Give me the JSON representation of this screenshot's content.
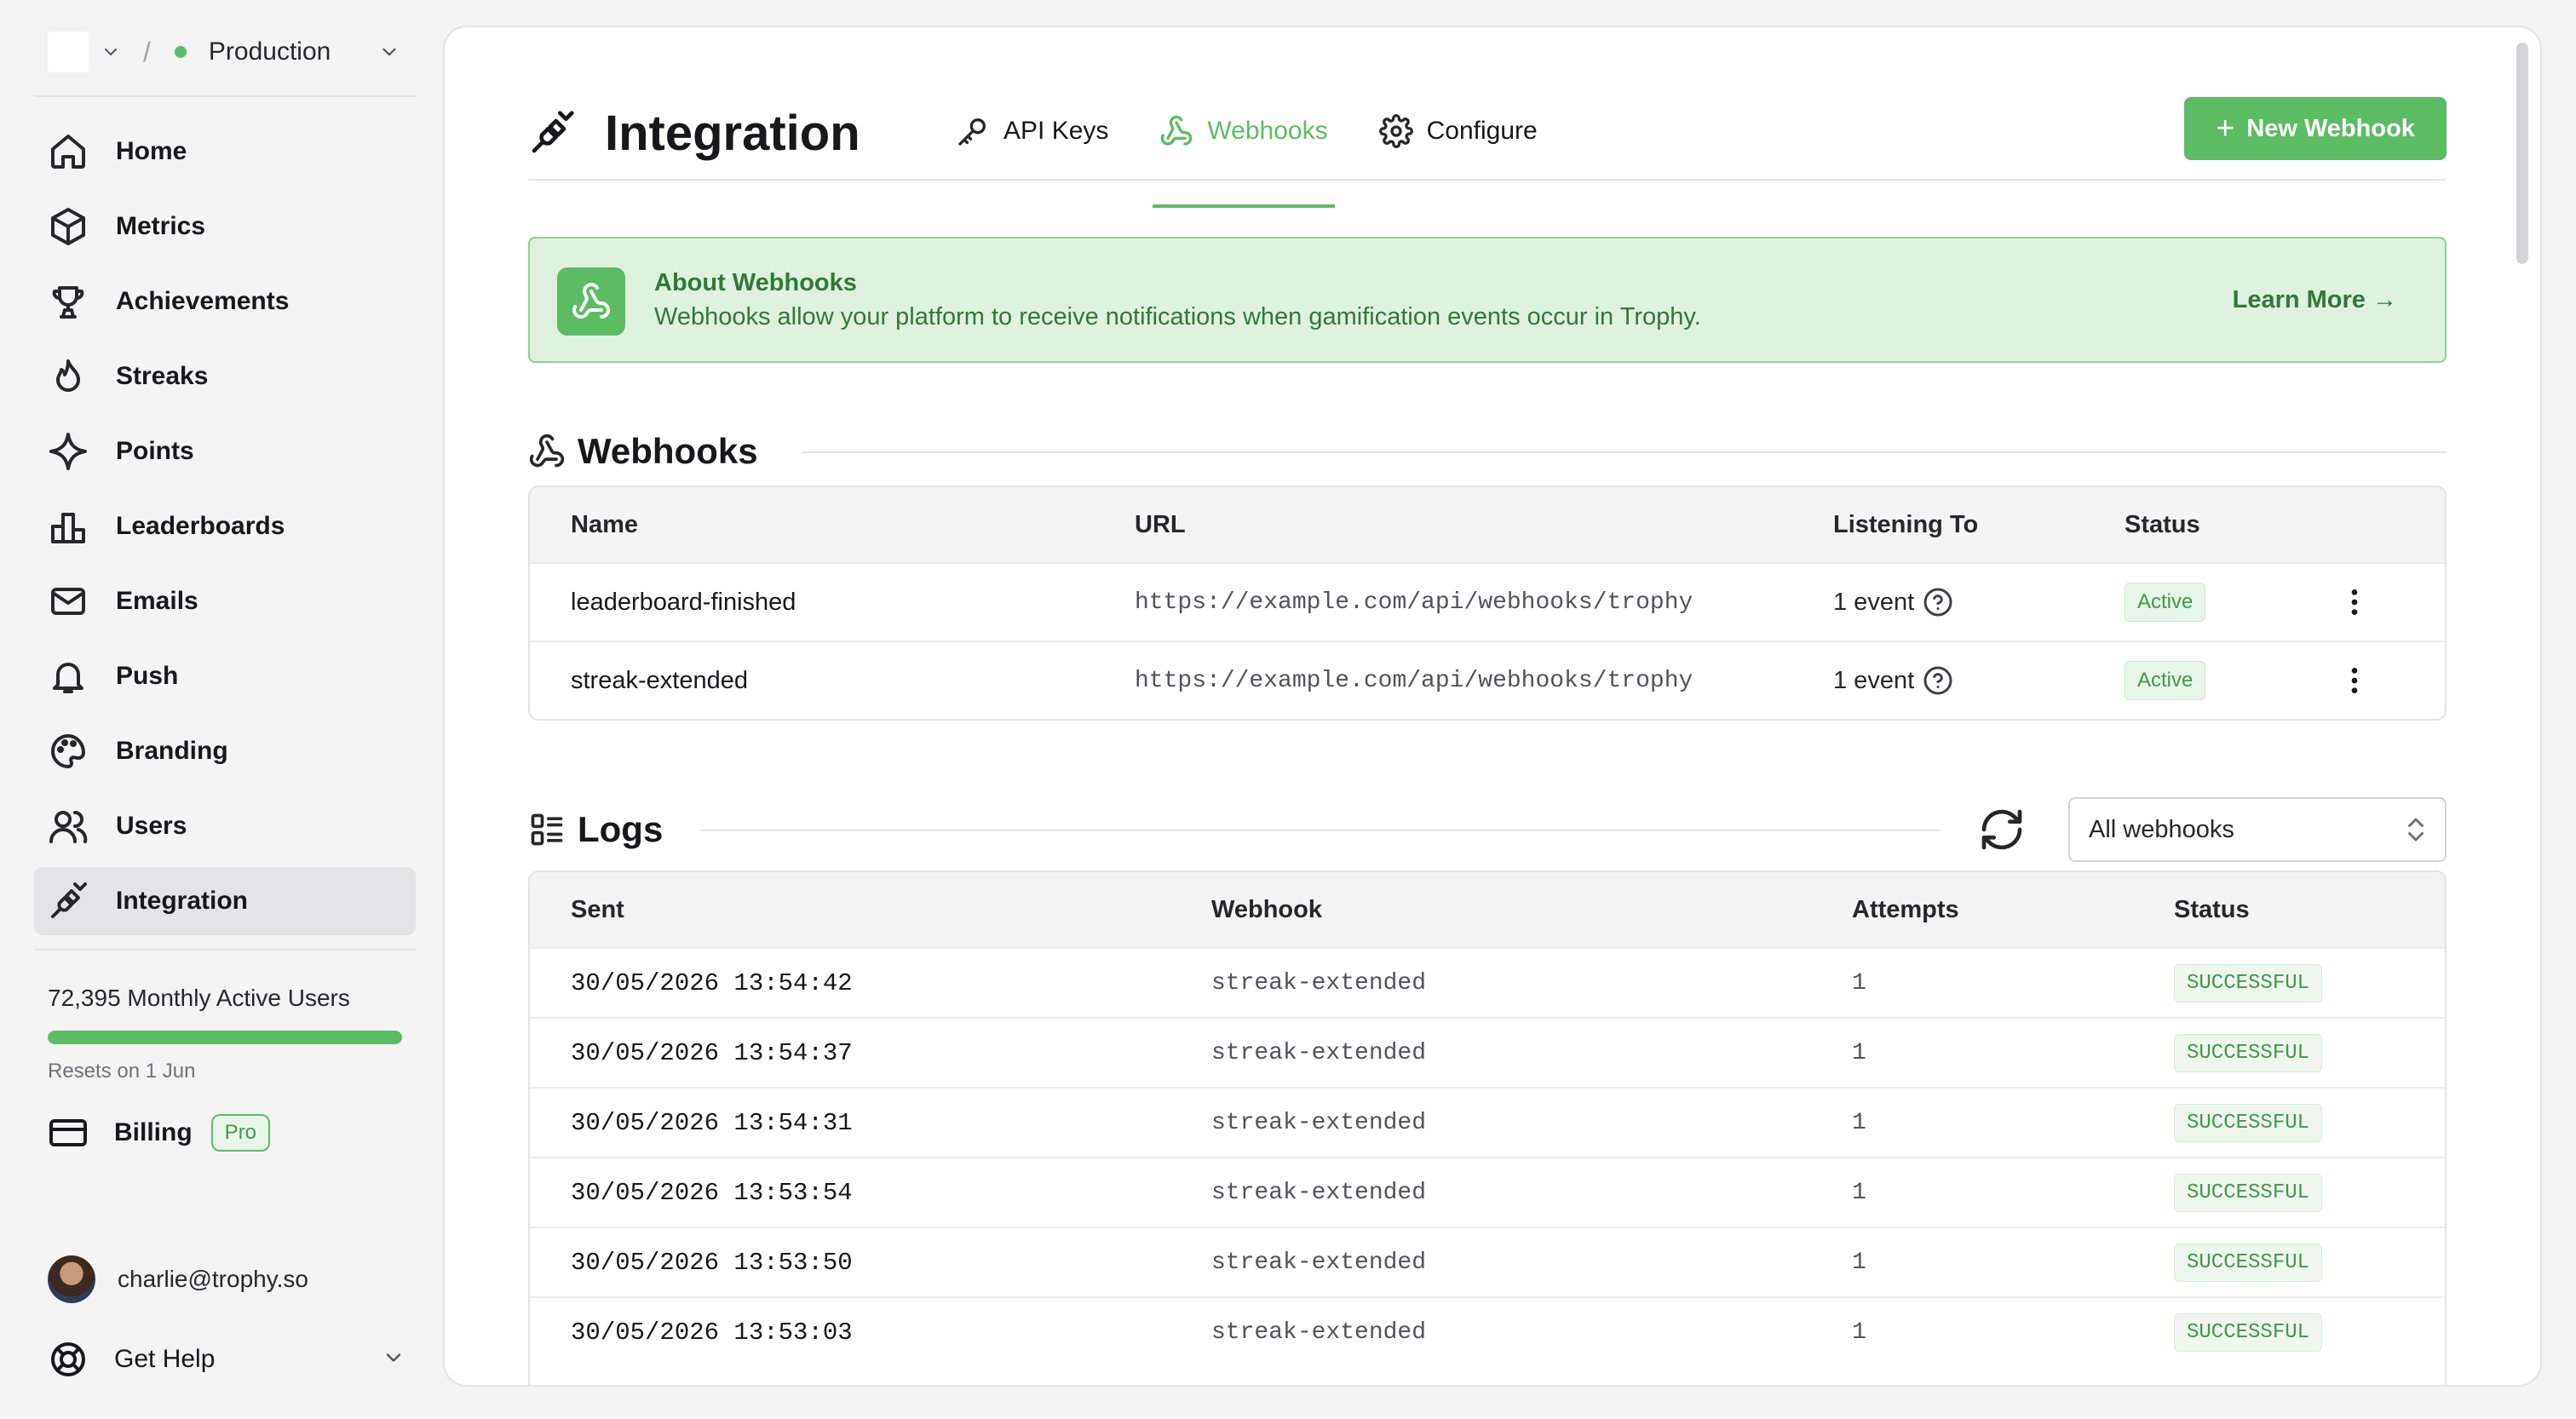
{
  "workspace": {
    "environment": "Production",
    "env_status_color": "#5cbc63"
  },
  "sidebar": {
    "items": [
      {
        "label": "Home",
        "icon": "home-icon"
      },
      {
        "label": "Metrics",
        "icon": "cube-icon"
      },
      {
        "label": "Achievements",
        "icon": "trophy-icon"
      },
      {
        "label": "Streaks",
        "icon": "flame-icon"
      },
      {
        "label": "Points",
        "icon": "sparkle-icon"
      },
      {
        "label": "Leaderboards",
        "icon": "bar-chart-icon"
      },
      {
        "label": "Emails",
        "icon": "mail-icon"
      },
      {
        "label": "Push",
        "icon": "bell-icon"
      },
      {
        "label": "Branding",
        "icon": "palette-icon"
      },
      {
        "label": "Users",
        "icon": "users-icon"
      },
      {
        "label": "Integration",
        "icon": "plug-icon",
        "active": true
      }
    ],
    "usage": {
      "label": "72,395 Monthly Active Users",
      "progress": 1.0,
      "resets": "Resets on 1 Jun"
    },
    "billing": {
      "label": "Billing",
      "plan_badge": "Pro"
    },
    "user": {
      "email": "charlie@trophy.so"
    },
    "help": {
      "label": "Get Help"
    }
  },
  "page": {
    "title": "Integration",
    "tabs": [
      {
        "label": "API Keys",
        "icon": "key-icon"
      },
      {
        "label": "Webhooks",
        "icon": "webhook-icon",
        "active": true
      },
      {
        "label": "Configure",
        "icon": "gear-icon"
      }
    ],
    "new_button": {
      "plus": "+",
      "label": "New Webhook"
    }
  },
  "banner": {
    "title": "About Webhooks",
    "text": "Webhooks allow your platform to receive notifications when gamification events occur in Trophy.",
    "link": "Learn More →"
  },
  "webhooks": {
    "title": "Webhooks",
    "columns": [
      "Name",
      "URL",
      "Listening To",
      "Status"
    ],
    "rows": [
      {
        "name": "leaderboard-finished",
        "url": "https://example.com/api/webhooks/trophy",
        "listening": "1 event",
        "status": "Active"
      },
      {
        "name": "streak-extended",
        "url": "https://example.com/api/webhooks/trophy",
        "listening": "1 event",
        "status": "Active"
      }
    ]
  },
  "logs": {
    "title": "Logs",
    "filter": {
      "selected": "All webhooks"
    },
    "columns": [
      "Sent",
      "Webhook",
      "Attempts",
      "Status"
    ],
    "rows": [
      {
        "sent": "30/05/2026 13:54:42",
        "webhook": "streak-extended",
        "attempts": "1",
        "status": "SUCCESSFUL"
      },
      {
        "sent": "30/05/2026 13:54:37",
        "webhook": "streak-extended",
        "attempts": "1",
        "status": "SUCCESSFUL"
      },
      {
        "sent": "30/05/2026 13:54:31",
        "webhook": "streak-extended",
        "attempts": "1",
        "status": "SUCCESSFUL"
      },
      {
        "sent": "30/05/2026 13:53:54",
        "webhook": "streak-extended",
        "attempts": "1",
        "status": "SUCCESSFUL"
      },
      {
        "sent": "30/05/2026 13:53:50",
        "webhook": "streak-extended",
        "attempts": "1",
        "status": "SUCCESSFUL"
      },
      {
        "sent": "30/05/2026 13:53:03",
        "webhook": "streak-extended",
        "attempts": "1",
        "status": "SUCCESSFUL"
      }
    ]
  },
  "colors": {
    "accent": "#5cbc63",
    "banner_bg": "#dff2e0",
    "banner_text": "#2f7a35"
  }
}
